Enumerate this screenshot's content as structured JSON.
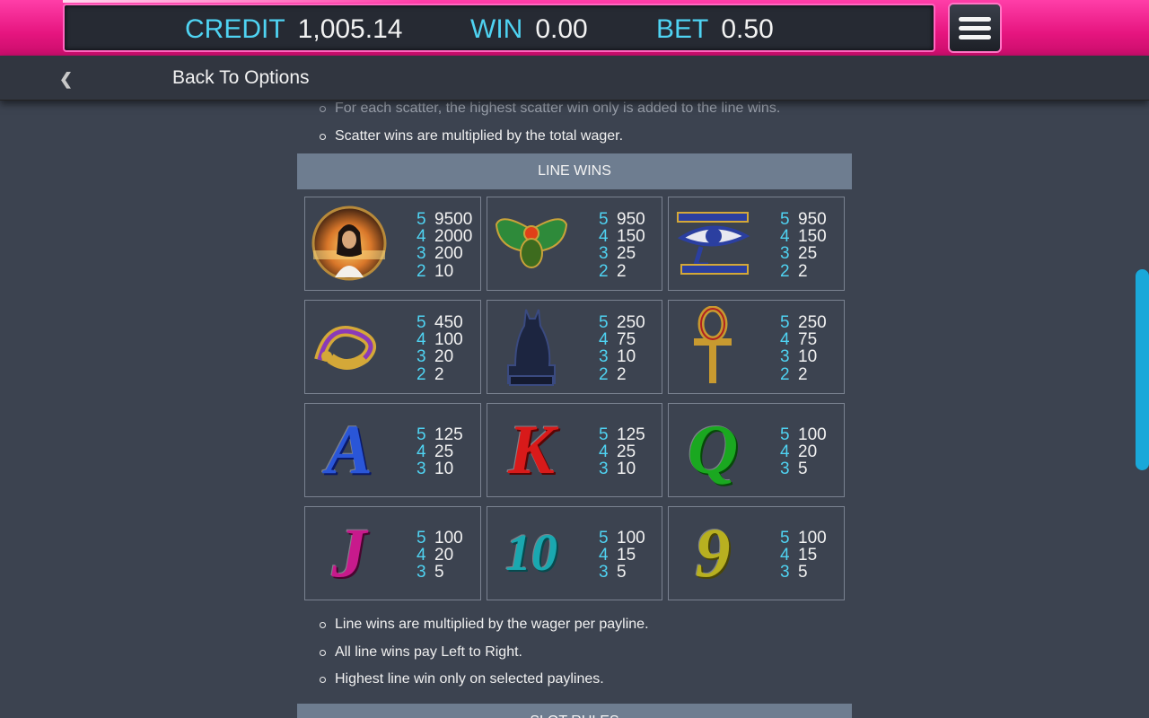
{
  "header": {
    "credit_label": "CREDIT",
    "credit_value": "1,005.14",
    "win_label": "WIN",
    "win_value": "0.00",
    "bet_label": "BET",
    "bet_value": "0.50"
  },
  "nav": {
    "back_label": "Back To Options"
  },
  "scatter_rules": [
    "For each scatter, the highest scatter win only is added to the line wins.",
    "Scatter wins are multiplied by the total wager."
  ],
  "line_wins": {
    "title": "LINE WINS",
    "symbols": [
      {
        "icon": "queen-portrait-icon",
        "pays": [
          [
            "5",
            "9500"
          ],
          [
            "4",
            "2000"
          ],
          [
            "3",
            "200"
          ],
          [
            "2",
            "10"
          ]
        ]
      },
      {
        "icon": "scarab-icon",
        "pays": [
          [
            "5",
            "950"
          ],
          [
            "4",
            "150"
          ],
          [
            "3",
            "25"
          ],
          [
            "2",
            "2"
          ]
        ]
      },
      {
        "icon": "eye-of-horus-icon",
        "pays": [
          [
            "5",
            "950"
          ],
          [
            "4",
            "150"
          ],
          [
            "3",
            "25"
          ],
          [
            "2",
            "2"
          ]
        ]
      },
      {
        "icon": "cobra-icon",
        "pays": [
          [
            "5",
            "450"
          ],
          [
            "4",
            "100"
          ],
          [
            "3",
            "20"
          ],
          [
            "2",
            "2"
          ]
        ]
      },
      {
        "icon": "cat-statue-icon",
        "pays": [
          [
            "5",
            "250"
          ],
          [
            "4",
            "75"
          ],
          [
            "3",
            "10"
          ],
          [
            "2",
            "2"
          ]
        ]
      },
      {
        "icon": "ankh-icon",
        "pays": [
          [
            "5",
            "250"
          ],
          [
            "4",
            "75"
          ],
          [
            "3",
            "10"
          ],
          [
            "2",
            "2"
          ]
        ]
      },
      {
        "icon": "letter-a-icon",
        "pays": [
          [
            "5",
            "125"
          ],
          [
            "4",
            "25"
          ],
          [
            "3",
            "10"
          ]
        ]
      },
      {
        "icon": "letter-k-icon",
        "pays": [
          [
            "5",
            "125"
          ],
          [
            "4",
            "25"
          ],
          [
            "3",
            "10"
          ]
        ]
      },
      {
        "icon": "letter-q-icon",
        "pays": [
          [
            "5",
            "100"
          ],
          [
            "4",
            "20"
          ],
          [
            "3",
            "5"
          ]
        ]
      },
      {
        "icon": "letter-j-icon",
        "pays": [
          [
            "5",
            "100"
          ],
          [
            "4",
            "20"
          ],
          [
            "3",
            "5"
          ]
        ]
      },
      {
        "icon": "number-10-icon",
        "pays": [
          [
            "5",
            "100"
          ],
          [
            "4",
            "15"
          ],
          [
            "3",
            "5"
          ]
        ]
      },
      {
        "icon": "number-9-icon",
        "pays": [
          [
            "5",
            "100"
          ],
          [
            "4",
            "15"
          ],
          [
            "3",
            "5"
          ]
        ]
      }
    ]
  },
  "line_rules": [
    "Line wins are multiplied by the wager per payline.",
    "All line wins pay Left to Right.",
    "Highest line win only on selected paylines."
  ],
  "slot_rules_title": "SLOT RULES",
  "colors": {
    "accent_pink": "#e6157f",
    "label_cyan": "#4fd3f2",
    "background": "#3c4350",
    "section_header": "#6e7d90",
    "scrollbar": "#1aa8d9"
  }
}
